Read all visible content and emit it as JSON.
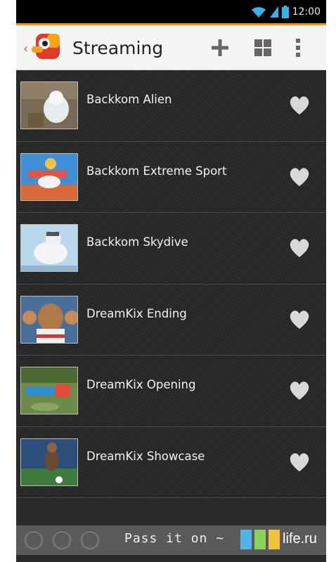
{
  "status_bar": {
    "time": "12:00",
    "wifi_icon": "wifi-icon",
    "signal_icon": "signal-icon",
    "battery_icon": "battery-icon"
  },
  "action_bar": {
    "title": "Streaming",
    "add_icon": "plus-icon",
    "grid_icon": "grid-view-icon",
    "overflow_icon": "overflow-menu-icon",
    "accent_color": "#ff8a00"
  },
  "list": {
    "items": [
      {
        "label": "Backkom Alien"
      },
      {
        "label": "Backkom Extreme Sport"
      },
      {
        "label": "Backkom Skydive"
      },
      {
        "label": "DreamKix Ending"
      },
      {
        "label": "DreamKix Opening"
      },
      {
        "label": "DreamKix Showcase"
      }
    ],
    "favorite_icon": "heart-icon"
  },
  "bottom_bar": {
    "text": "Pass it on ~"
  },
  "watermark": {
    "text": "life.ru"
  }
}
